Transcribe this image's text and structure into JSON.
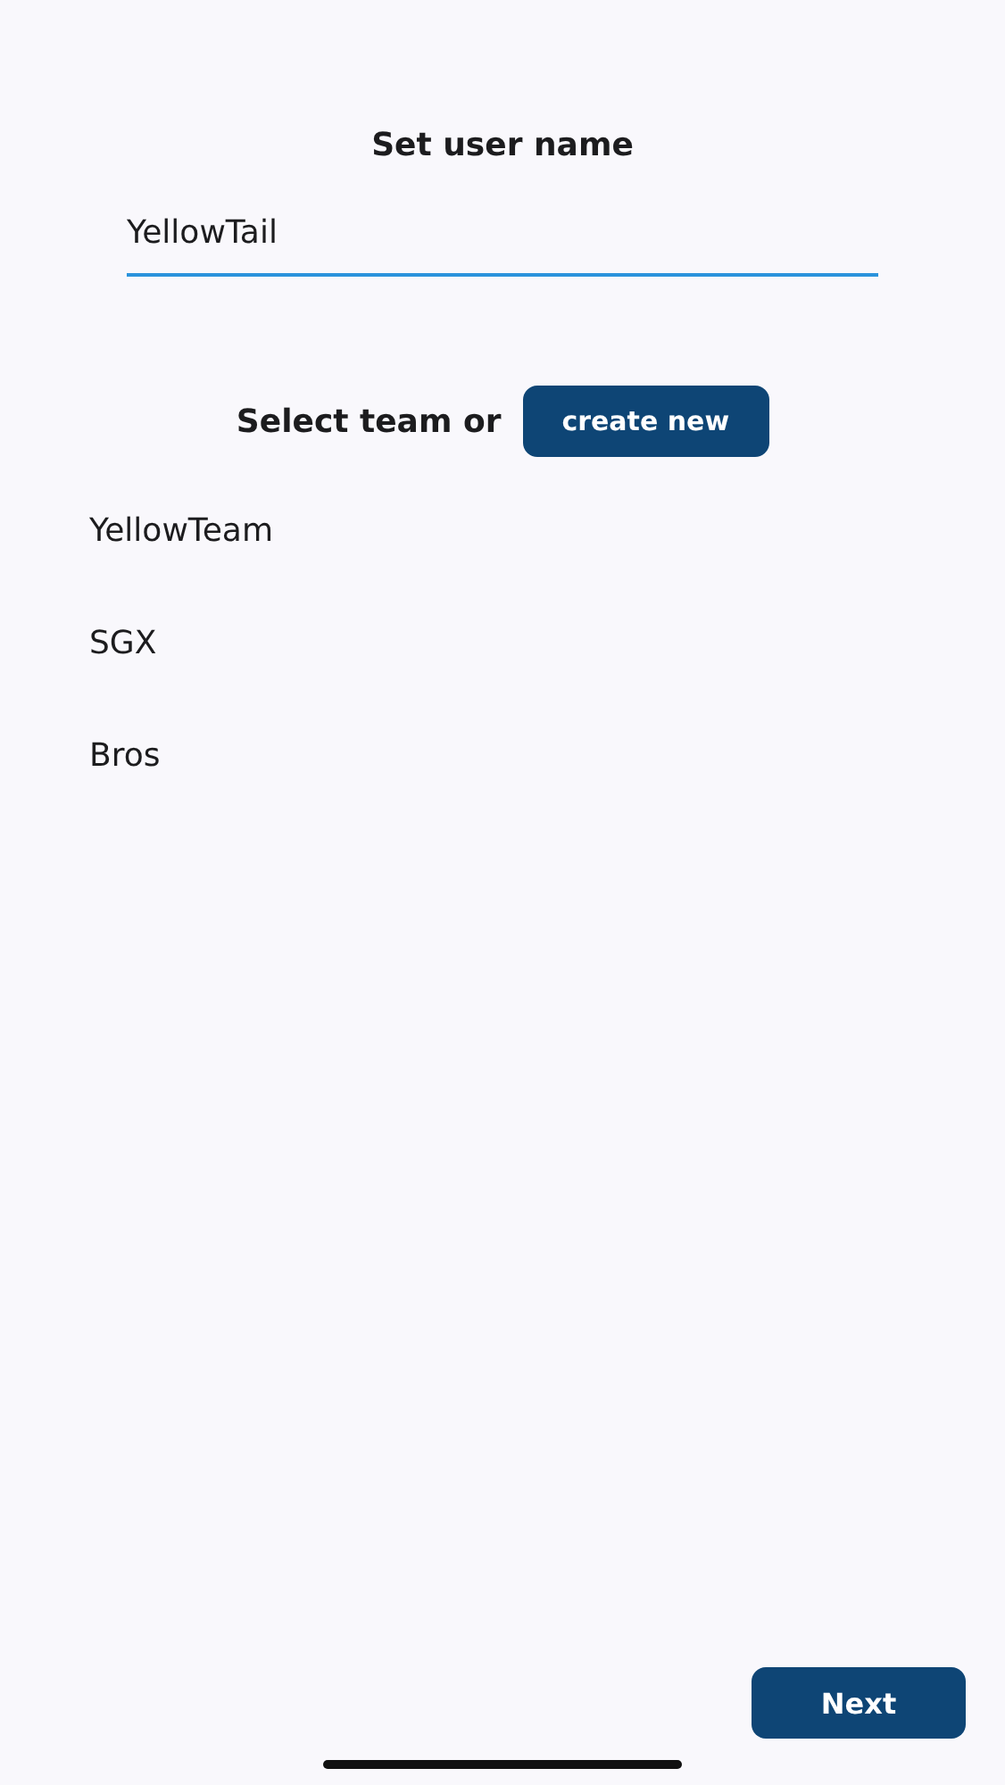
{
  "title": "Set user name",
  "username": {
    "value": "YellowTail"
  },
  "team_prompt": "Select team or",
  "create_button": "create new",
  "teams": [
    {
      "name": "YellowTeam"
    },
    {
      "name": "SGX"
    },
    {
      "name": "Bros"
    }
  ],
  "next_button": "Next"
}
